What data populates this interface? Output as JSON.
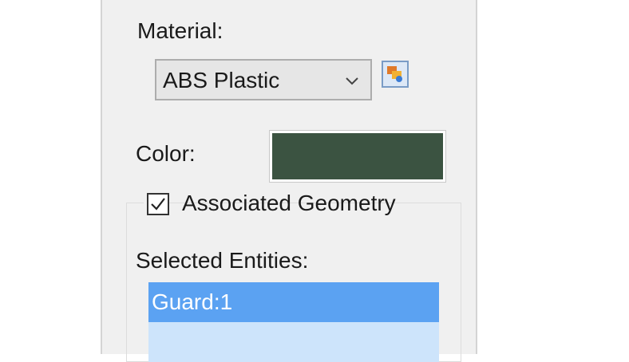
{
  "material": {
    "label": "Material:",
    "selected": "ABS Plastic",
    "button_icon": "material-editor-icon"
  },
  "color": {
    "label": "Color:",
    "value": "#3b5341"
  },
  "associated_geometry": {
    "label": "Associated Geometry",
    "checked": true
  },
  "selected_entities": {
    "label": "Selected Entities:",
    "items": [
      "Guard:1"
    ]
  },
  "colors": {
    "selection": "#5ba2f2",
    "list_background": "#cde4fb",
    "panel_background": "#f0f0f0"
  }
}
